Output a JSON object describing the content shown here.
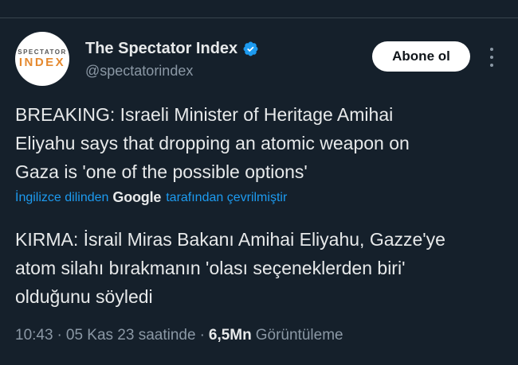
{
  "author": {
    "avatar_top": "SPECTATOR",
    "avatar_bottom": "INDEX",
    "name": "The Spectator Index",
    "handle": "@spectatorindex",
    "verified_icon": "verified-badge-icon",
    "verified_color": "#1d9bf0"
  },
  "actions": {
    "follow_label": "Abone ol",
    "more_icon": "more-vertical-icon"
  },
  "tweet": {
    "lines": [
      "BREAKING: Israeli Minister of Heritage Amihai",
      "Eliyahu says that dropping an atomic weapon on",
      "Gaza is 'one of the possible options'"
    ]
  },
  "translation_notice": {
    "prefix": "İngilizce dilinden",
    "brand": "Google",
    "suffix": "tarafından çevrilmiştir"
  },
  "translation": {
    "lines": [
      "KIRMA: İsrail Miras Bakanı Amihai Eliyahu, Gazze'ye",
      "atom silahı bırakmanın 'olası seçeneklerden biri'",
      "olduğunu söyledi"
    ]
  },
  "meta": {
    "time": "10:43",
    "date": "05 Kas 23 saatinde",
    "views": "6,5Mn",
    "views_label": "Görüntüleme",
    "separator": "·"
  },
  "colors": {
    "background": "#15202b",
    "accent": "#1d9bf0",
    "text": "#e7e9ea",
    "muted": "#8b98a5"
  }
}
